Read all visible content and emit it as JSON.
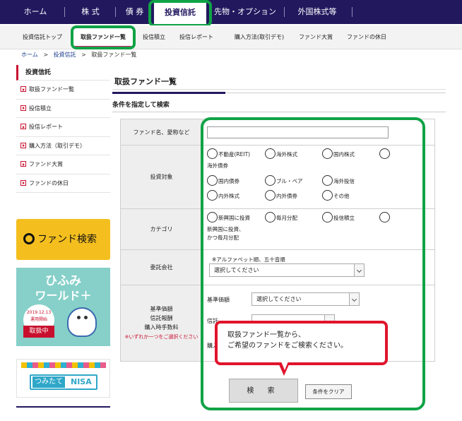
{
  "topnav": {
    "items": [
      "ホーム",
      "株 式",
      "債 券",
      "投資信託",
      "先物・オプション",
      "外国株式等"
    ],
    "active": "投資信託"
  },
  "subnav": {
    "items": [
      "投資信託トップ",
      "取扱ファンド一覧",
      "投信積立",
      "投信レポート",
      "購入方法(取引デモ)",
      "ファンド大賞",
      "ファンドの休日"
    ],
    "active": "取扱ファンド一覧"
  },
  "breadcrumb": {
    "home": "ホーム",
    "sep": ">",
    "parent": "投資信託",
    "current": "取扱ファンド一覧"
  },
  "sidebar": {
    "heading": "投資信託",
    "items": [
      "取扱ファンド一覧",
      "投信積立",
      "投信レポート",
      "購入方法（取引デモ）",
      "ファンド大賞",
      "ファンドの休日"
    ]
  },
  "banners": {
    "fund_search": "ファンド検索",
    "hifumi_title1": "ひふみ",
    "hifumi_title2": "ワールド＋",
    "hifumi_date1": "2019.12.13",
    "hifumi_date2": "運用開始",
    "hifumi_badge": "取扱中",
    "nisa_text1": "つみたて",
    "nisa_text2": "NISA"
  },
  "page": {
    "title": "取扱ファンド一覧",
    "section": "条件を指定して検索"
  },
  "form": {
    "fund_name_label": "ファンド名、愛称など",
    "fund_name_value": "",
    "target_label": "投資対象",
    "target_options": [
      "不動産(REIT)",
      "海外株式",
      "国内株式",
      "海外債券",
      "国内債券",
      "ブル・ベア",
      "海外投信",
      "内外株式",
      "内外債券",
      "その他"
    ],
    "category_label": "カテゴリ",
    "category_options": [
      "新興国に投資",
      "毎月分配",
      "投信積立",
      "新興国に投資、",
      "かつ毎月分配"
    ],
    "trustee_label": "委託会社",
    "trustee_note": "※アルファベット順、五十音順",
    "trustee_select": "選択してください",
    "fee_labels": [
      "基準価額",
      "信託報酬",
      "購入時手数料"
    ],
    "fee_note": "※いずれか一つをご選択ください",
    "fee_row1_label": "基準価額",
    "fee_row1_select": "選択してください",
    "fee_row2_label": "信託報酬",
    "fee_row3_label": "購入時手数料",
    "search_button": "検 索",
    "clear_button": "条件をクリア"
  },
  "callout": {
    "line1": "取扱ファンド一覧から、",
    "line2": "ご希望のファンドをご検索ください。"
  },
  "colors": {
    "nav": "#22185e",
    "highlight_green": "#10a346",
    "highlight_red": "#e0142c",
    "fund_search_bg": "#f4bf1e",
    "accent": "#c8102e"
  }
}
